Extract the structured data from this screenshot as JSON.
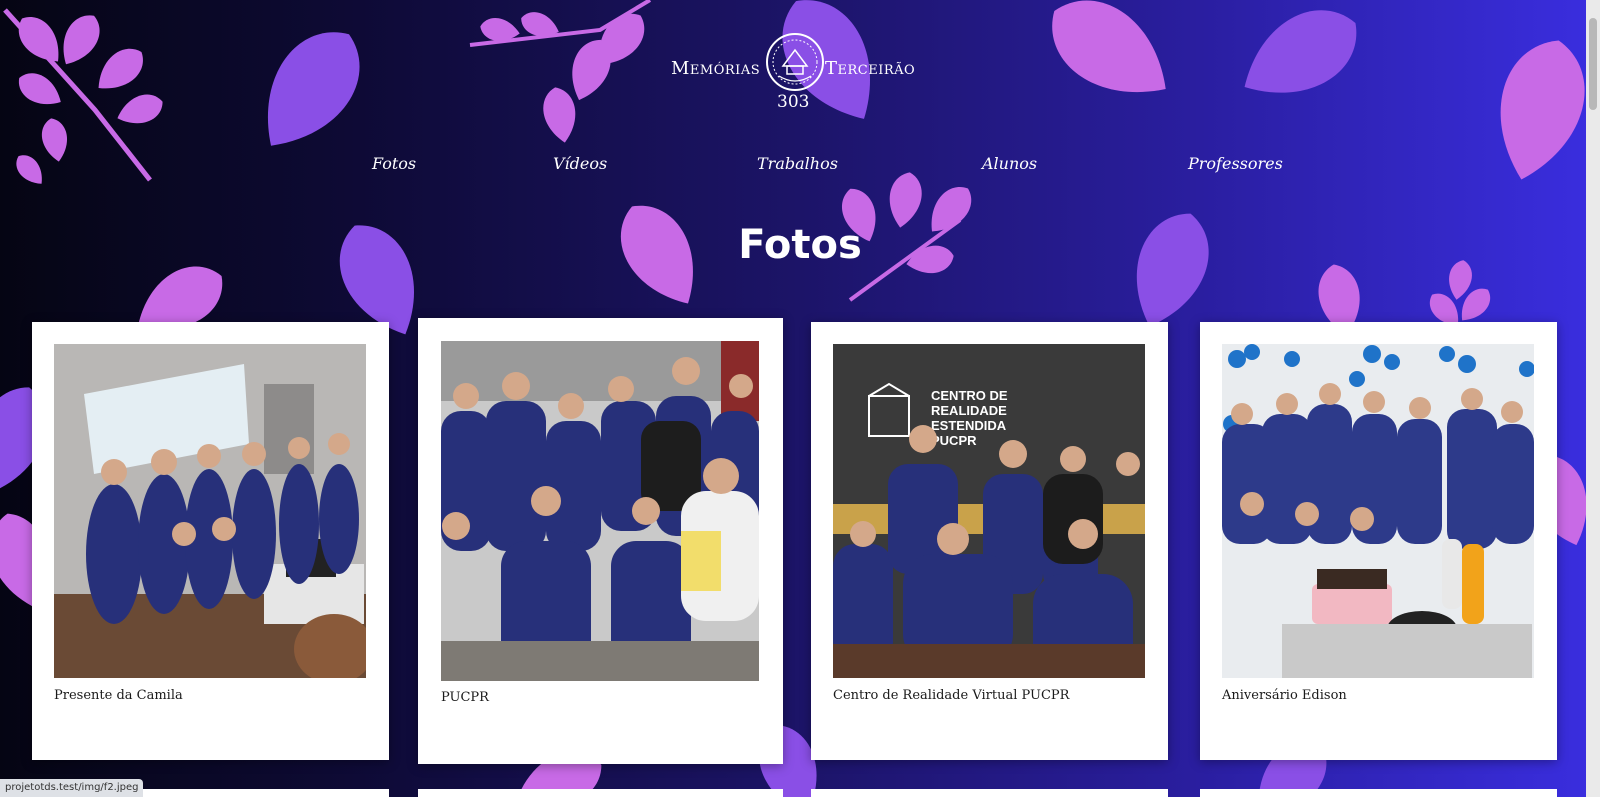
{
  "logo": {
    "left_word": "Memórias",
    "right_word": "Terceirão",
    "class_number": "303"
  },
  "nav": {
    "items": [
      {
        "label": "Fotos"
      },
      {
        "label": "Vídeos"
      },
      {
        "label": "Trabalhos"
      },
      {
        "label": "Alunos"
      },
      {
        "label": "Professores"
      }
    ]
  },
  "page_title": "Fotos",
  "cards": [
    {
      "caption": "Presente da Camila"
    },
    {
      "caption": "PUCPR"
    },
    {
      "caption": "Centro de Realidade Virtual PUCPR"
    },
    {
      "caption": "Aniversário Edison"
    }
  ],
  "photo_signage": {
    "line1": "CENTRO DE",
    "line2": "REALIDADE",
    "line3": "ESTENDIDA",
    "line4": "PUCPR"
  },
  "status_url": "projetotds.test/img/f2.jpeg",
  "colors": {
    "leaf_pink": "#c86ae6",
    "leaf_purple": "#8a4fe6",
    "background_dark": "#050513",
    "background_blue": "#3a2ee0",
    "shirt_navy": "#27307a"
  }
}
